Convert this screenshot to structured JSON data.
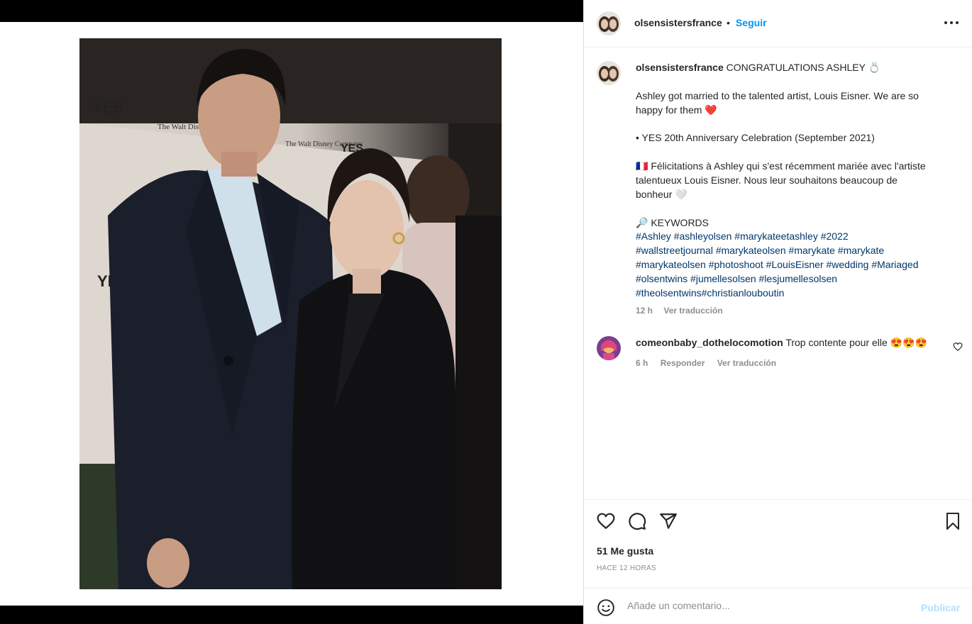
{
  "post": {
    "username": "olsensistersfrance",
    "dot": "•",
    "follow_label": "Seguir",
    "more_icon": "more-options-icon"
  },
  "caption": {
    "username": "olsensistersfrance",
    "lines": [
      "CONGRATULATIONS ASHLEY 💍",
      "",
      "Ashley got married to the talented artist, Louis Eisner. We are so",
      "happy for them ❤️",
      "",
      "• YES 20th Anniversary Celebration (September 2021)",
      "",
      "🇫🇷 Félicitations à Ashley qui s'est récemment mariée avec l'artiste",
      "talentueux Louis Eisner. Nous leur souhaitons beaucoup de",
      "bonheur 🤍",
      "",
      "🔎 KEYWORDS"
    ],
    "hashtag_lines": [
      "#Ashley #ashleyolsen #marykateetashley #2022",
      "#wallstreetjournal #marykateolsen #marykate #marykate",
      "#marykateolsen #photoshoot #LouisEisner #wedding #Mariaged",
      "#olsentwins #jumellesolsen #lesjumellesolsen",
      "#theolsentwins#christianlouboutin"
    ],
    "time": "12 h",
    "translate": "Ver traducción"
  },
  "comment": {
    "username": "comeonbaby_dothelocomotion",
    "text": "Trop contente pour elle 😍😍😍",
    "time": "6 h",
    "reply": "Responder",
    "translate": "Ver traducción"
  },
  "actions": {
    "likes": "51 Me gusta",
    "ago": "HACE 12 HORAS"
  },
  "add_comment": {
    "placeholder": "Añade un comentario...",
    "publish": "Publicar"
  },
  "colors": {
    "link": "#0095f6",
    "hashtag": "#00376b",
    "muted": "#8e8e8e"
  }
}
